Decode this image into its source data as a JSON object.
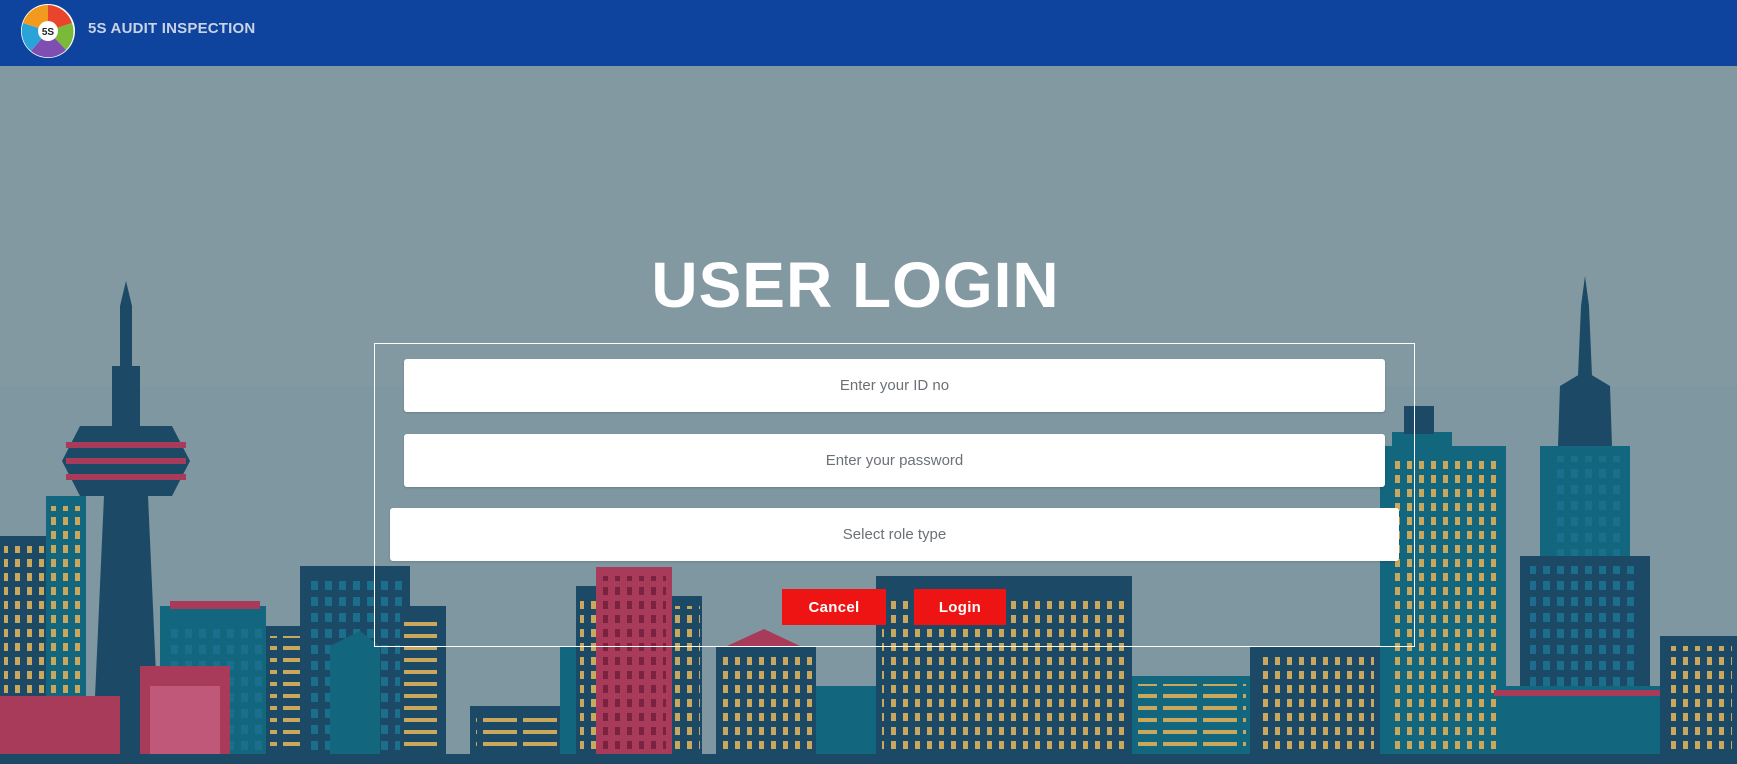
{
  "app": {
    "brand": "5S AUDIT INSPECTION",
    "logo_center_text": "5S"
  },
  "login": {
    "title": "USER LOGIN",
    "id_placeholder": "Enter your ID no",
    "password_placeholder": "Enter your password",
    "role_select_label": "Select role type",
    "cancel_label": "Cancel",
    "login_label": "Login"
  },
  "colors": {
    "navbar": "#0f449e",
    "sky": "#8299a2",
    "button": "#ef1414",
    "building_dark": "#1c4a66",
    "building_teal": "#12677e",
    "building_red": "#a83a5a",
    "window_gold": "#c9a85e"
  }
}
